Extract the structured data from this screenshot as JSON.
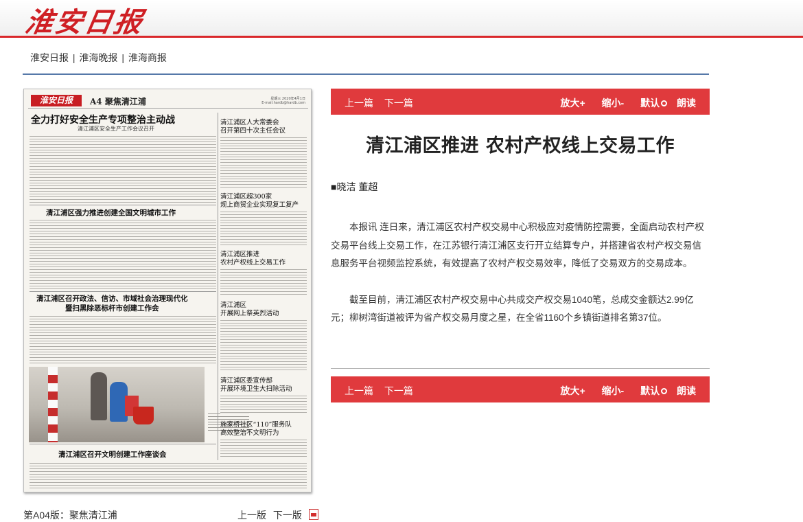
{
  "masthead": {
    "logo_text": "淮安日报"
  },
  "site_nav": {
    "items": [
      "淮安日报",
      "淮海晚报",
      "淮海商报"
    ],
    "separator": "|"
  },
  "paper": {
    "mast_logo": "淮安日报",
    "section": "A4 聚焦清江浦",
    "meta_line1": "星期三 2020年4月1日",
    "meta_line2": "E-mail:hardb@hardb.com",
    "headline_main": "全力打好安全生产专项整治主动战",
    "headline_main_sub": "清江浦区安全生产工作会议召开",
    "headline_2": "清江浦区强力推进创建全国文明城市工作",
    "headline_3a": "清江浦区召开政法、信访、市域社会治理现代化",
    "headline_3b": "暨扫黑除恶标杆市创建工作会",
    "headline_4": "清江浦区召开文明创建工作座谈会",
    "side_1a": "清江浦区人大常委会",
    "side_1b": "召开第四十次主任会议",
    "side_2a": "清江浦区超300家",
    "side_2b": "规上商贸企业实现复工复产",
    "side_3a": "清江浦区推进",
    "side_3b": "农村产权线上交易工作",
    "side_4a": "清江浦区",
    "side_4b": "开展网上祭英烈活动",
    "side_5a": "清江浦区委宣传部",
    "side_5b": "开展环境卫生大扫除活动",
    "side_6a": "施家桥社区“110”服务队",
    "side_6b": "高效整治不文明行为"
  },
  "page_info": "第A04版：聚焦清江浦",
  "page_nav": {
    "prev": "上一版",
    "next": "下一版"
  },
  "article_toolbar": {
    "prev": "上一篇",
    "next": "下一篇",
    "zoom_in": "放大+",
    "zoom_out": "缩小-",
    "default": "默认",
    "read_aloud": "朗读"
  },
  "article": {
    "title": "清江浦区推进 农村产权线上交易工作",
    "author": "■晓洁 董超",
    "paragraphs": [
      "本报讯 连日来，清江浦区农村产权交易中心积极应对疫情防控需要，全面启动农村产权交易平台线上交易工作，在江苏银行清江浦区支行开立结算专户，并搭建省农村产权交易信息服务平台视频监控系统，有效提高了农村产权交易效率，降低了交易双方的交易成本。",
      "截至目前，清江浦区农村产权交易中心共成交产权交易1040笔，总成交金额达2.99亿元；柳树湾街道被评为省产权交易月度之星，在全省1160个乡镇街道排名第37位。"
    ]
  },
  "colors": {
    "accent_red": "#e03a3d",
    "nav_line_blue": "#5679a9",
    "logo_red": "#cf1f24"
  },
  "icons": {
    "default_toggle": "ring-icon",
    "pdf": "pdf-icon"
  }
}
